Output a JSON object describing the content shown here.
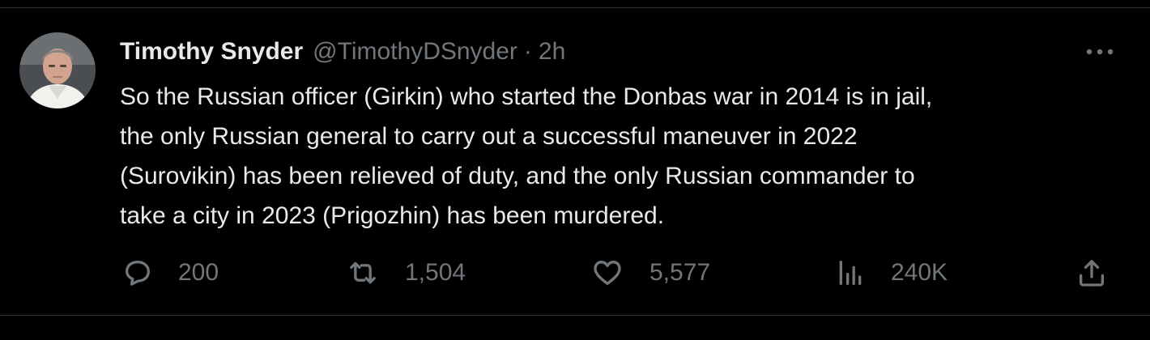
{
  "tweet": {
    "author": {
      "name": "Timothy Snyder",
      "handle": "@TimothyDSnyder"
    },
    "separator": "·",
    "time": "2h",
    "text": "So the Russian officer (Girkin) who started the Donbas war in 2014 is in jail,\nthe only Russian general to carry out a successful maneuver in 2022\n(Surovikin) has been relieved of duty, and the only Russian commander to\ntake a city in 2023 (Prigozhin) has been murdered.",
    "actions": {
      "replies": "200",
      "retweets": "1,504",
      "likes": "5,577",
      "views": "240K"
    },
    "icons": {
      "more": "more-dots-icon",
      "reply": "reply-icon",
      "retweet": "retweet-icon",
      "like": "heart-icon",
      "views": "analytics-icon",
      "share": "share-icon"
    }
  },
  "colors": {
    "background": "#000000",
    "text_primary": "#e7e9ea",
    "text_secondary": "#71767b",
    "divider": "#2f3336"
  }
}
